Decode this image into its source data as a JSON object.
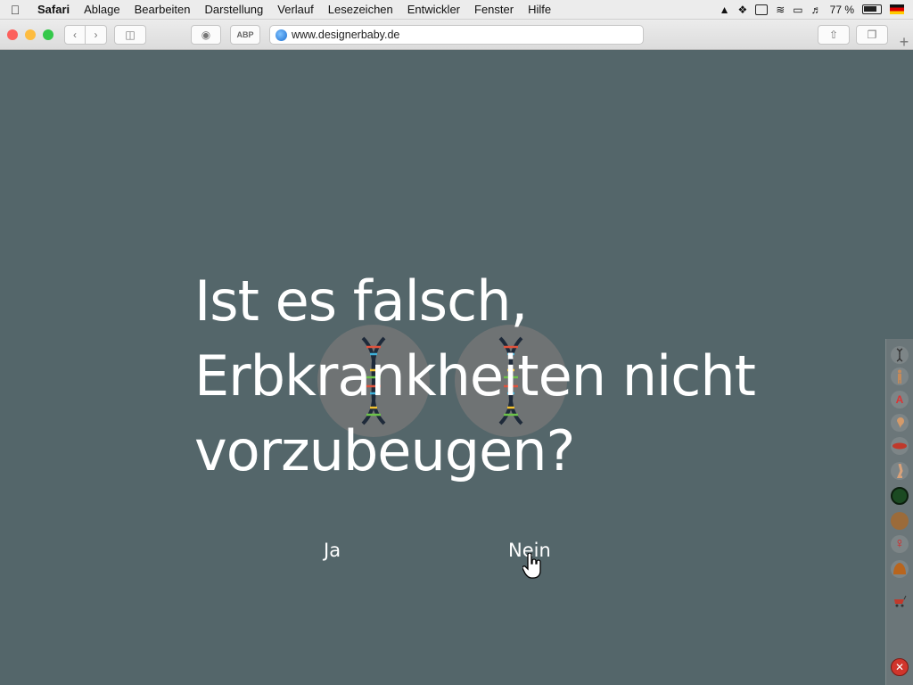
{
  "menubar": {
    "app_name": "Safari",
    "items": [
      "Ablage",
      "Bearbeiten",
      "Darstellung",
      "Verlauf",
      "Lesezeichen",
      "Entwickler",
      "Fenster",
      "Hilfe"
    ],
    "battery_text": "77 %"
  },
  "browser": {
    "url": "www.designerbaby.de",
    "abp_label": "ABP",
    "tab_add_label": "+"
  },
  "page": {
    "question_lines": [
      "Ist es falsch,",
      "Erbkrankheiten nicht",
      "vorzubeugen?"
    ],
    "answer_yes": "Ja",
    "answer_no": "Nein"
  },
  "sidebar": {
    "icons": [
      "dna-icon",
      "body-icon",
      "letter-a-icon",
      "ear-icon",
      "lips-icon",
      "leg-icon",
      "eye-color-icon",
      "skin-color-icon",
      "female-icon",
      "hair-icon",
      "wagon-icon",
      "close-icon"
    ],
    "letter_a": "A"
  },
  "colors": {
    "background": "#54666a",
    "text": "#ffffff",
    "circle": "#7a7a7a"
  }
}
